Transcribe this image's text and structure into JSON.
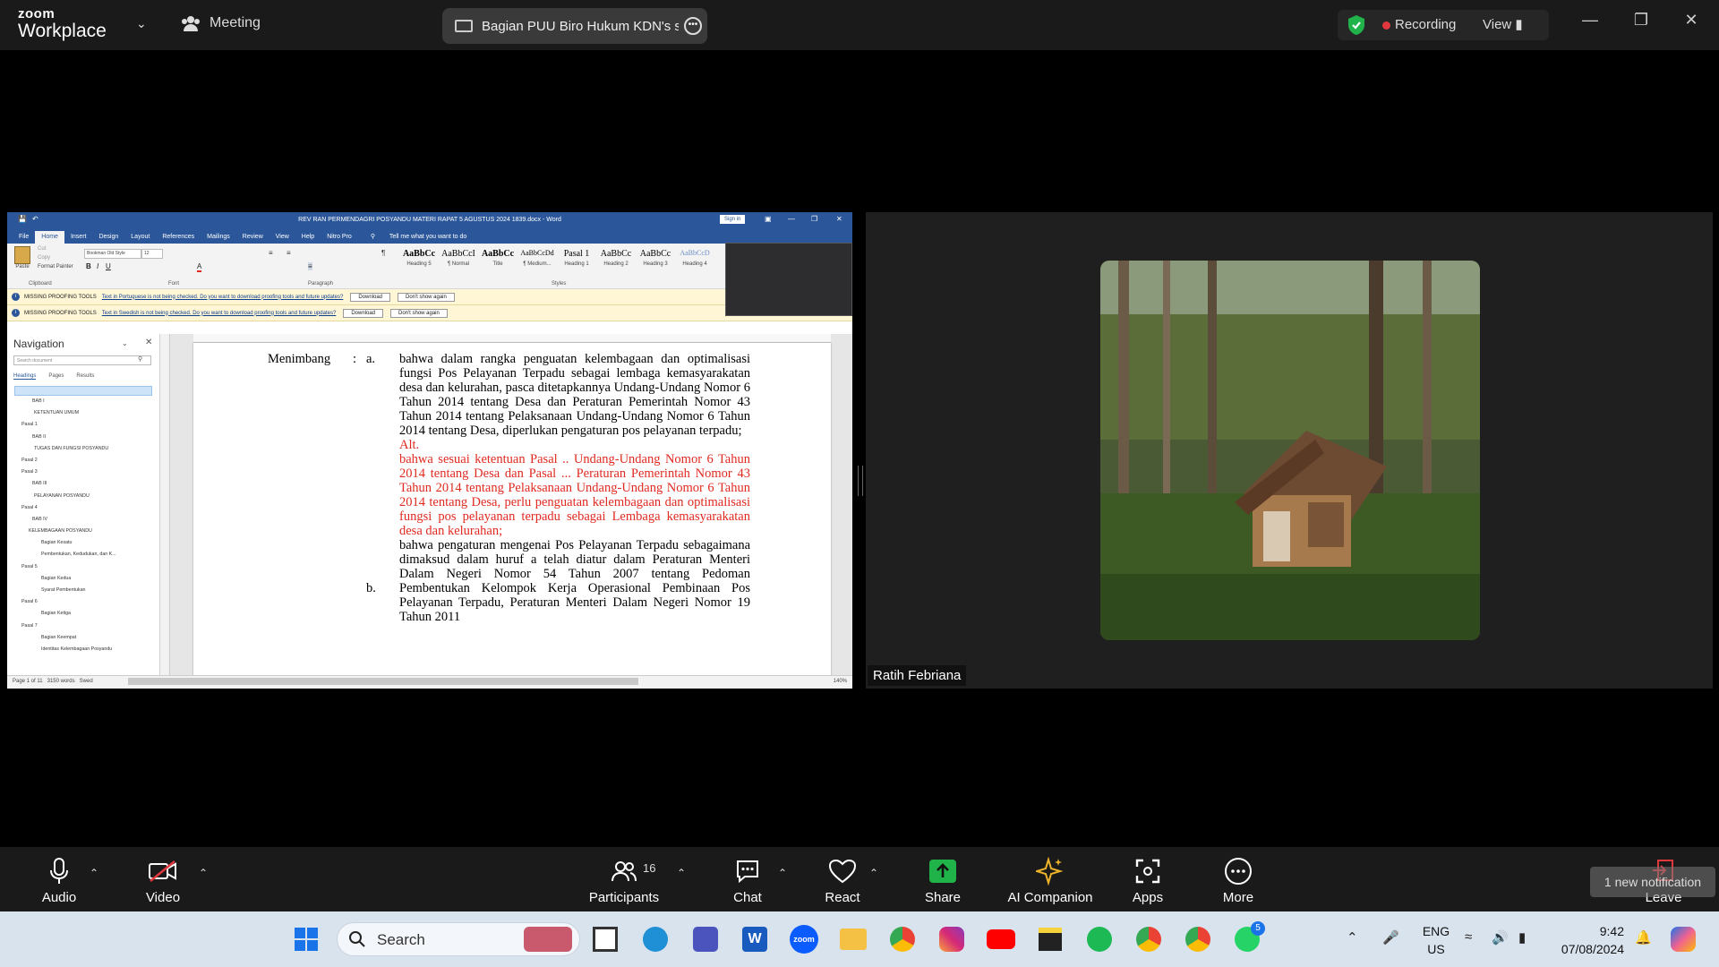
{
  "topbar": {
    "brand_top": "zoom",
    "brand_bottom": "Workplace",
    "meeting_label": "Meeting",
    "share_title": "Bagian PUU Biro Hukum KDN's s",
    "recording_label": "Recording",
    "view_label": "View",
    "accent_green": "#1fb34a",
    "recording_color": "#e0373d"
  },
  "word": {
    "title": "REV RAN PERMENDAGRI POSYANDU MATERI RAPAT 5 AGUSTUS 2024 1839.docx - Word",
    "sign_in": "Sign in",
    "tabs": [
      "File",
      "Home",
      "Insert",
      "Design",
      "Layout",
      "References",
      "Mailings",
      "Review",
      "View",
      "Help",
      "Nitro Pro"
    ],
    "tell_me": "Tell me what you want to do",
    "clipboard": {
      "paste": "Paste",
      "cut": "Cut",
      "copy": "Copy",
      "format_painter": "Format Painter",
      "group": "Clipboard"
    },
    "font": {
      "name": "Bookman Old Style",
      "size": "12",
      "group": "Font"
    },
    "paragraph_group": "Paragraph",
    "styles_group": "Styles",
    "styles": [
      {
        "preview": "AaBbCc",
        "name": "Heading 5"
      },
      {
        "preview": "AaBbCcI",
        "name": "¶ Normal"
      },
      {
        "preview": "AaBbCc",
        "name": "Title"
      },
      {
        "preview": "AaBbCcDd",
        "name": "¶ Medium..."
      },
      {
        "preview": "Pasal 1",
        "name": "Heading 1"
      },
      {
        "preview": "AaBbCc",
        "name": "Heading 2"
      },
      {
        "preview": "AaBbCc",
        "name": "Heading 3"
      },
      {
        "preview": "AaBbCcD",
        "name": "Heading 4"
      }
    ],
    "messages": [
      {
        "label": "MISSING PROOFING TOOLS",
        "text": "Text in Portuguese is not being checked. Do you want to download proofing tools and future updates?",
        "download": "Download",
        "dismiss": "Don't show again"
      },
      {
        "label": "MISSING PROOFING TOOLS",
        "text": "Text in Swedish is not being checked. Do you want to download proofing tools and future updates?",
        "download": "Download",
        "dismiss": "Don't show again"
      }
    ],
    "navigation": {
      "title": "Navigation",
      "search_placeholder": "Search document",
      "tabs": [
        "Headings",
        "Pages",
        "Results"
      ],
      "items": [
        "BAB I",
        "KETENTUAN UMUM",
        "Pasal 1",
        "BAB II",
        "TUGAS DAN FUNGSI POSYANDU",
        "Pasal 2",
        "Pasal 3",
        "BAB III",
        "PELAYANAN POSYANDU",
        "Pasal 4",
        "BAB IV",
        "KELEMBAGAAN POSYANDU",
        "Bagian Kesatu",
        "Pembentukan, Kedudukan, dan K...",
        "Pasal 5",
        "Bagian Kedua",
        "Syarat Pembentukan",
        "Pasal 6",
        "Bagian Ketiga",
        "Pasal 7",
        "Bagian Keempat",
        "Identitas Kelembagaan Posyandu"
      ]
    },
    "document": {
      "label": "Menimbang",
      "colon": ":",
      "item_a": "a.",
      "para_a": "bahwa dalam rangka penguatan kelembagaan dan optimalisasi fungsi Pos Pelayanan Terpadu sebagai lembaga kemasyarakatan desa dan kelurahan, pasca ditetapkannya Undang-Undang Nomor 6 Tahun 2014 tentang Desa dan Peraturan Pemerintah Nomor 43 Tahun 2014 tentang Pelaksanaan Undang-Undang Nomor 6 Tahun 2014 tentang Desa, diperlukan pengaturan pos pelayanan terpadu;",
      "alt_label": "Alt.",
      "alt_text": "bahwa sesuai ketentuan Pasal .. Undang-Undang Nomor 6 Tahun 2014 tentang Desa dan Pasal ... Peraturan Pemerintah Nomor 43 Tahun 2014 tentang Pelaksanaan Undang-Undang Nomor 6 Tahun 2014 tentang Desa, perlu penguatan kelembagaan dan optimalisasi fungsi pos pelayanan terpadu sebagai Lembaga kemasyarakatan desa dan kelurahan;",
      "item_b": "b.",
      "para_b": "bahwa pengaturan mengenai Pos Pelayanan Terpadu sebagaimana dimaksud dalam huruf a telah diatur dalam Peraturan Menteri Dalam Negeri Nomor 54 Tahun 2007 tentang Pedoman Pembentukan Kelompok Kerja Operasional Pembinaan Pos Pelayanan Terpadu, Peraturan Menteri Dalam Negeri Nomor 19 Tahun 2011",
      "red_color": "#e02a20"
    },
    "status": {
      "page": "Page 1 of 11",
      "words": "3150 words",
      "lang": "Swed",
      "zoom": "140%"
    }
  },
  "participant": {
    "name": "Ratih Febriana"
  },
  "toolbar": {
    "audio": "Audio",
    "video": "Video",
    "participants": "Participants",
    "participants_count": "16",
    "chat": "Chat",
    "react": "React",
    "share": "Share",
    "ai_companion": "AI Companion",
    "apps": "Apps",
    "more": "More",
    "leave": "Leave",
    "notification": "1 new notification"
  },
  "taskbar": {
    "search": "Search",
    "lang_top": "ENG",
    "lang_bottom": "US",
    "time": "9:42",
    "date": "07/08/2024",
    "whatsapp_badge": "5"
  }
}
